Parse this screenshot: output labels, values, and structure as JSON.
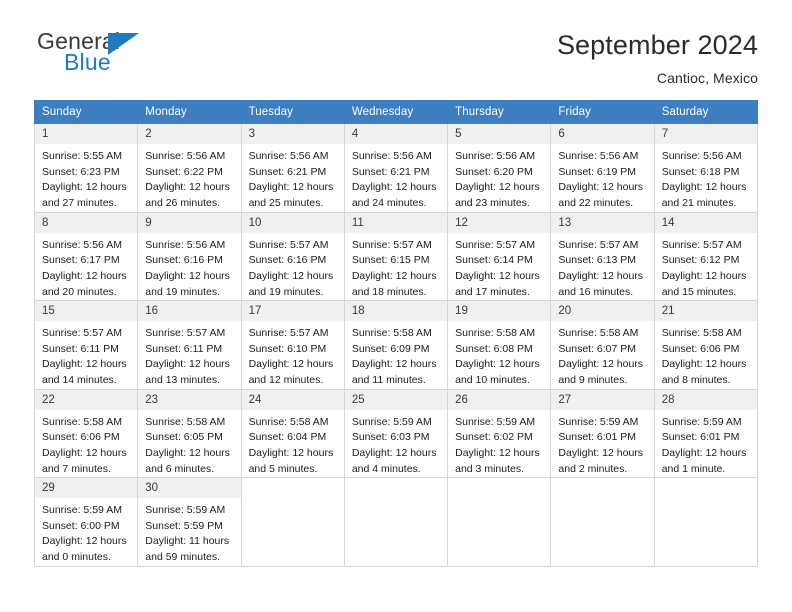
{
  "brand": {
    "word_general": "General",
    "word_blue": "Blue",
    "logo_icon": "triangle-flag-icon"
  },
  "header": {
    "month_title": "September 2024",
    "location": "Cantioc, Mexico"
  },
  "calendar": {
    "weekdays": [
      "Sunday",
      "Monday",
      "Tuesday",
      "Wednesday",
      "Thursday",
      "Friday",
      "Saturday"
    ],
    "accent_color": "#3c7ebf",
    "daynum_bg": "#f0f0f0",
    "weeks": [
      [
        {
          "day": "1",
          "sunrise": "Sunrise: 5:55 AM",
          "sunset": "Sunset: 6:23 PM",
          "daylight1": "Daylight: 12 hours",
          "daylight2": "and 27 minutes."
        },
        {
          "day": "2",
          "sunrise": "Sunrise: 5:56 AM",
          "sunset": "Sunset: 6:22 PM",
          "daylight1": "Daylight: 12 hours",
          "daylight2": "and 26 minutes."
        },
        {
          "day": "3",
          "sunrise": "Sunrise: 5:56 AM",
          "sunset": "Sunset: 6:21 PM",
          "daylight1": "Daylight: 12 hours",
          "daylight2": "and 25 minutes."
        },
        {
          "day": "4",
          "sunrise": "Sunrise: 5:56 AM",
          "sunset": "Sunset: 6:21 PM",
          "daylight1": "Daylight: 12 hours",
          "daylight2": "and 24 minutes."
        },
        {
          "day": "5",
          "sunrise": "Sunrise: 5:56 AM",
          "sunset": "Sunset: 6:20 PM",
          "daylight1": "Daylight: 12 hours",
          "daylight2": "and 23 minutes."
        },
        {
          "day": "6",
          "sunrise": "Sunrise: 5:56 AM",
          "sunset": "Sunset: 6:19 PM",
          "daylight1": "Daylight: 12 hours",
          "daylight2": "and 22 minutes."
        },
        {
          "day": "7",
          "sunrise": "Sunrise: 5:56 AM",
          "sunset": "Sunset: 6:18 PM",
          "daylight1": "Daylight: 12 hours",
          "daylight2": "and 21 minutes."
        }
      ],
      [
        {
          "day": "8",
          "sunrise": "Sunrise: 5:56 AM",
          "sunset": "Sunset: 6:17 PM",
          "daylight1": "Daylight: 12 hours",
          "daylight2": "and 20 minutes."
        },
        {
          "day": "9",
          "sunrise": "Sunrise: 5:56 AM",
          "sunset": "Sunset: 6:16 PM",
          "daylight1": "Daylight: 12 hours",
          "daylight2": "and 19 minutes."
        },
        {
          "day": "10",
          "sunrise": "Sunrise: 5:57 AM",
          "sunset": "Sunset: 6:16 PM",
          "daylight1": "Daylight: 12 hours",
          "daylight2": "and 19 minutes."
        },
        {
          "day": "11",
          "sunrise": "Sunrise: 5:57 AM",
          "sunset": "Sunset: 6:15 PM",
          "daylight1": "Daylight: 12 hours",
          "daylight2": "and 18 minutes."
        },
        {
          "day": "12",
          "sunrise": "Sunrise: 5:57 AM",
          "sunset": "Sunset: 6:14 PM",
          "daylight1": "Daylight: 12 hours",
          "daylight2": "and 17 minutes."
        },
        {
          "day": "13",
          "sunrise": "Sunrise: 5:57 AM",
          "sunset": "Sunset: 6:13 PM",
          "daylight1": "Daylight: 12 hours",
          "daylight2": "and 16 minutes."
        },
        {
          "day": "14",
          "sunrise": "Sunrise: 5:57 AM",
          "sunset": "Sunset: 6:12 PM",
          "daylight1": "Daylight: 12 hours",
          "daylight2": "and 15 minutes."
        }
      ],
      [
        {
          "day": "15",
          "sunrise": "Sunrise: 5:57 AM",
          "sunset": "Sunset: 6:11 PM",
          "daylight1": "Daylight: 12 hours",
          "daylight2": "and 14 minutes."
        },
        {
          "day": "16",
          "sunrise": "Sunrise: 5:57 AM",
          "sunset": "Sunset: 6:11 PM",
          "daylight1": "Daylight: 12 hours",
          "daylight2": "and 13 minutes."
        },
        {
          "day": "17",
          "sunrise": "Sunrise: 5:57 AM",
          "sunset": "Sunset: 6:10 PM",
          "daylight1": "Daylight: 12 hours",
          "daylight2": "and 12 minutes."
        },
        {
          "day": "18",
          "sunrise": "Sunrise: 5:58 AM",
          "sunset": "Sunset: 6:09 PM",
          "daylight1": "Daylight: 12 hours",
          "daylight2": "and 11 minutes."
        },
        {
          "day": "19",
          "sunrise": "Sunrise: 5:58 AM",
          "sunset": "Sunset: 6:08 PM",
          "daylight1": "Daylight: 12 hours",
          "daylight2": "and 10 minutes."
        },
        {
          "day": "20",
          "sunrise": "Sunrise: 5:58 AM",
          "sunset": "Sunset: 6:07 PM",
          "daylight1": "Daylight: 12 hours",
          "daylight2": "and 9 minutes."
        },
        {
          "day": "21",
          "sunrise": "Sunrise: 5:58 AM",
          "sunset": "Sunset: 6:06 PM",
          "daylight1": "Daylight: 12 hours",
          "daylight2": "and 8 minutes."
        }
      ],
      [
        {
          "day": "22",
          "sunrise": "Sunrise: 5:58 AM",
          "sunset": "Sunset: 6:06 PM",
          "daylight1": "Daylight: 12 hours",
          "daylight2": "and 7 minutes."
        },
        {
          "day": "23",
          "sunrise": "Sunrise: 5:58 AM",
          "sunset": "Sunset: 6:05 PM",
          "daylight1": "Daylight: 12 hours",
          "daylight2": "and 6 minutes."
        },
        {
          "day": "24",
          "sunrise": "Sunrise: 5:58 AM",
          "sunset": "Sunset: 6:04 PM",
          "daylight1": "Daylight: 12 hours",
          "daylight2": "and 5 minutes."
        },
        {
          "day": "25",
          "sunrise": "Sunrise: 5:59 AM",
          "sunset": "Sunset: 6:03 PM",
          "daylight1": "Daylight: 12 hours",
          "daylight2": "and 4 minutes."
        },
        {
          "day": "26",
          "sunrise": "Sunrise: 5:59 AM",
          "sunset": "Sunset: 6:02 PM",
          "daylight1": "Daylight: 12 hours",
          "daylight2": "and 3 minutes."
        },
        {
          "day": "27",
          "sunrise": "Sunrise: 5:59 AM",
          "sunset": "Sunset: 6:01 PM",
          "daylight1": "Daylight: 12 hours",
          "daylight2": "and 2 minutes."
        },
        {
          "day": "28",
          "sunrise": "Sunrise: 5:59 AM",
          "sunset": "Sunset: 6:01 PM",
          "daylight1": "Daylight: 12 hours",
          "daylight2": "and 1 minute."
        }
      ],
      [
        {
          "day": "29",
          "sunrise": "Sunrise: 5:59 AM",
          "sunset": "Sunset: 6:00 PM",
          "daylight1": "Daylight: 12 hours",
          "daylight2": "and 0 minutes."
        },
        {
          "day": "30",
          "sunrise": "Sunrise: 5:59 AM",
          "sunset": "Sunset: 5:59 PM",
          "daylight1": "Daylight: 11 hours",
          "daylight2": "and 59 minutes."
        },
        {
          "day": "",
          "sunrise": "",
          "sunset": "",
          "daylight1": "",
          "daylight2": ""
        },
        {
          "day": "",
          "sunrise": "",
          "sunset": "",
          "daylight1": "",
          "daylight2": ""
        },
        {
          "day": "",
          "sunrise": "",
          "sunset": "",
          "daylight1": "",
          "daylight2": ""
        },
        {
          "day": "",
          "sunrise": "",
          "sunset": "",
          "daylight1": "",
          "daylight2": ""
        },
        {
          "day": "",
          "sunrise": "",
          "sunset": "",
          "daylight1": "",
          "daylight2": ""
        }
      ]
    ]
  }
}
